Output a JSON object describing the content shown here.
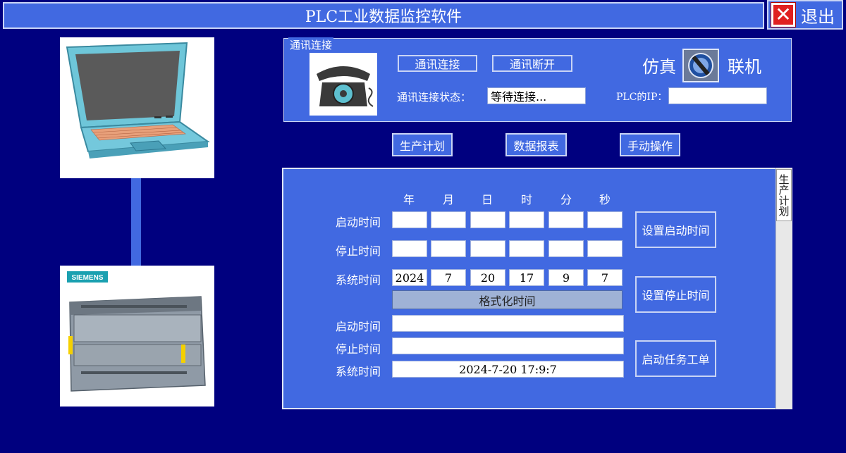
{
  "app": {
    "title": "PLC工业数据监控软件",
    "exit_label": "退出",
    "exit_icon": "close-x-icon"
  },
  "comm": {
    "group_title": "通讯连接",
    "connect_label": "通讯连接",
    "disconnect_label": "通讯断开",
    "status_label": "通讯连接状态：",
    "status_value": "等待连接...",
    "sim_label": "仿真",
    "online_label": "联机",
    "ip_label": "PLC的IP：",
    "ip_value": ""
  },
  "nav": {
    "plan": "生产计划",
    "report": "数据报表",
    "manual": "手动操作"
  },
  "plan_panel": {
    "tab_label": "生产计划",
    "columns": [
      "年",
      "月",
      "日",
      "时",
      "分",
      "秒"
    ],
    "start_label": "启动时间",
    "stop_label": "停止时间",
    "system_label": "系统时间",
    "start_values": [
      "",
      "",
      "",
      "",
      "",
      ""
    ],
    "stop_values": [
      "",
      "",
      "",
      "",
      "",
      ""
    ],
    "system_values": [
      "2024",
      "7",
      "20",
      "17",
      "9",
      "7"
    ],
    "format_button": "格式化时间",
    "formatted_start_label": "启动时间",
    "formatted_stop_label": "停止时间",
    "formatted_system_label": "系统时间",
    "formatted_start": "",
    "formatted_stop": "",
    "formatted_system": "2024-7-20 17:9:7",
    "set_start_button": "设置启动时间",
    "set_stop_button": "设置停止时间",
    "start_order_button": "启动任务工单"
  },
  "colors": {
    "background": "#00007f",
    "panel": "#4169e1",
    "exit_red": "#e02020"
  }
}
